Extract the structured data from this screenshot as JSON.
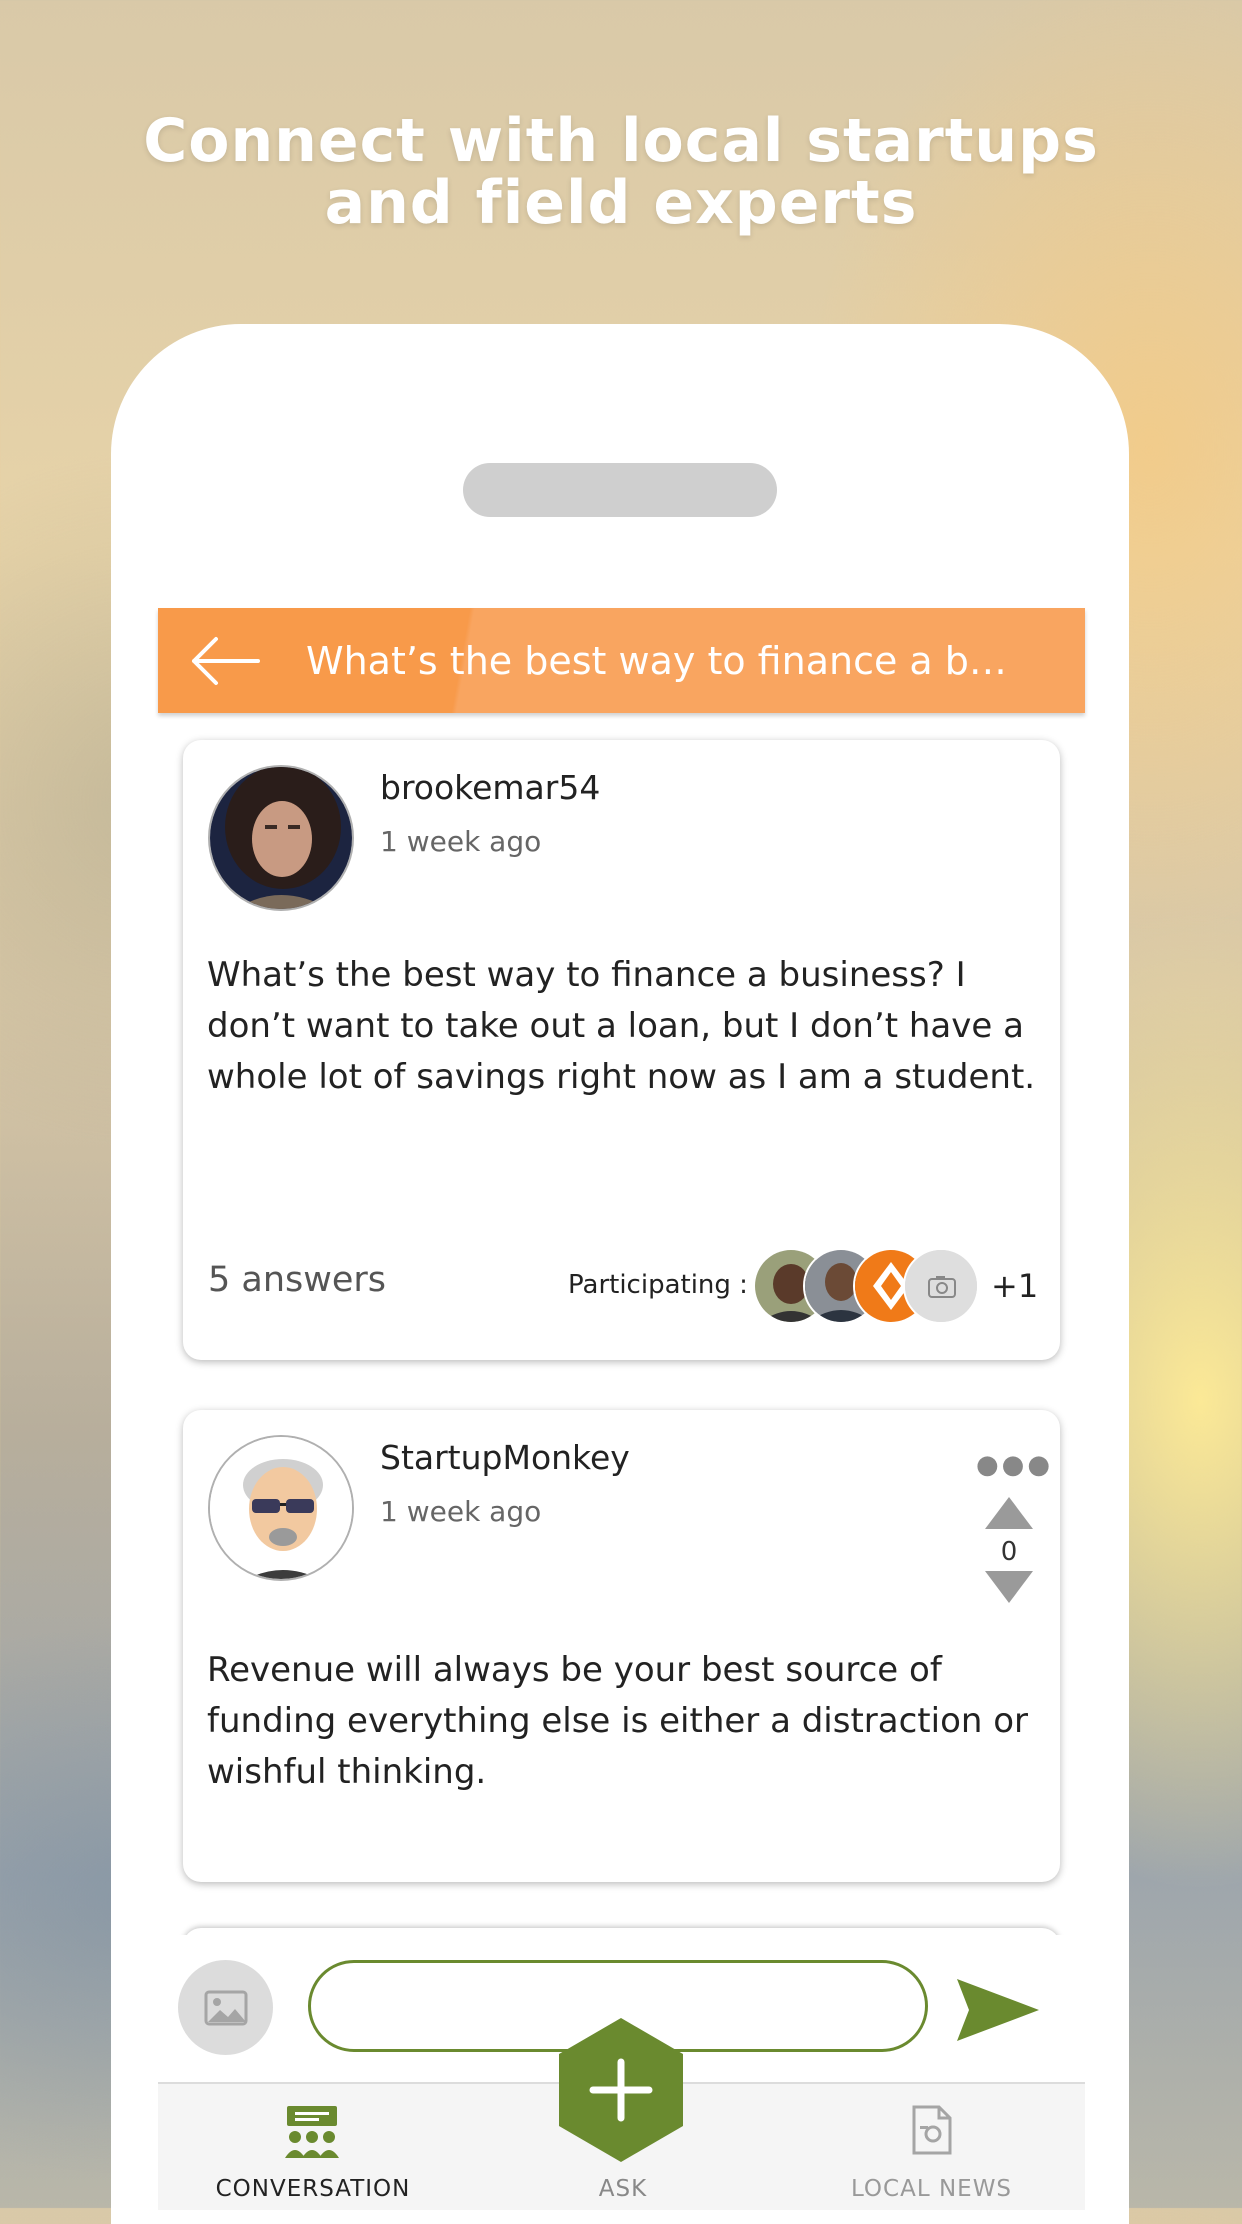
{
  "headline": {
    "line1": "Connect with local startups",
    "line2": "and field experts"
  },
  "header": {
    "title": "What’s the best way to finance a b…",
    "back_icon": "arrow-left-icon"
  },
  "question": {
    "username": "brookemar54",
    "time": "1 week ago",
    "text": "What’s the best way to finance a business? I don’t want to take out a loan, but I don’t have a whole lot of savings right now as I am a student.",
    "answers": "5 answers",
    "participating_label": "Participating :",
    "more_participants": "+1"
  },
  "answer": {
    "username": "StartupMonkey",
    "time": "1 week ago",
    "text": "Revenue will always be your best source of funding everything else is either a distraction or wishful thinking.",
    "votes": "0",
    "more_icon": "ellipsis-icon"
  },
  "composer": {
    "placeholder": "",
    "value": ""
  },
  "tabs": {
    "conversation": "CONVERSATION",
    "ask": "ASK",
    "local_news": "LOCAL NEWS"
  },
  "colors": {
    "header_orange": "#f89a4a",
    "accent_green": "#6a8a2f"
  }
}
